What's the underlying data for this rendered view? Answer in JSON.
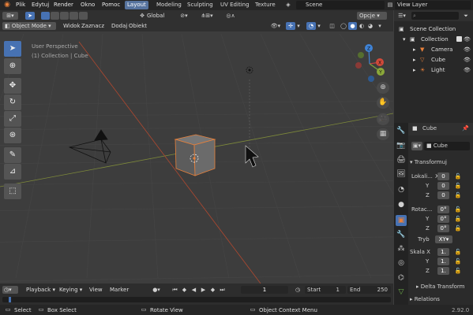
{
  "topbar": {
    "menus": [
      "Plik",
      "Edytuj",
      "Render",
      "Okno",
      "Pomoc"
    ],
    "workspaces": [
      "Layout",
      "Modeling",
      "Sculpting",
      "UV Editing",
      "Texture"
    ],
    "scene": "Scene",
    "view_layer": "View Layer"
  },
  "viewport": {
    "mode": "Object Mode",
    "view": "Widok",
    "select": "Zaznacz",
    "add": "Dodaj",
    "object": "Obiekt",
    "orientation": "Global",
    "options": "Opcje",
    "overlay_title": "User Perspective",
    "overlay_sub": "(1) Collection | Cube"
  },
  "gizmo": {
    "x": "X",
    "y": "Y",
    "z": "Z"
  },
  "timeline": {
    "playback": "Playback",
    "keying": "Keying",
    "view": "View",
    "marker": "Marker",
    "frame": "1",
    "start_label": "Start",
    "start": "1",
    "end_label": "End",
    "end": "250"
  },
  "status": {
    "select": "Select",
    "box_select": "Box Select",
    "rotate": "Rotate View",
    "context": "Object Context Menu",
    "version": "2.92.0"
  },
  "outliner": {
    "scene_collection": "Scene Collection",
    "collection": "Collection",
    "items": [
      "Camera",
      "Cube",
      "Light"
    ]
  },
  "properties": {
    "object_name": "Cube",
    "data_name": "Cube",
    "transform": "Transformuj",
    "location_label": "Lokali...",
    "rotation_label": "Rotac...",
    "mode_label": "Tryb",
    "mode": "XY",
    "scale_label": "Skala X",
    "x": "X",
    "y": "Y",
    "z": "Z",
    "loc": [
      "0",
      "0",
      "0"
    ],
    "rot": [
      "0°",
      "0°",
      "0°"
    ],
    "scale": [
      "1.",
      "1.",
      "1."
    ],
    "delta": "Delta Transform",
    "relations": "Relations"
  },
  "colors": {
    "accent": "#4772b3",
    "axis_x": "#d04a3a",
    "axis_y": "#8ba83a",
    "axis_z": "#3f83d6",
    "cube": "#6b6b6b",
    "object_orange": "#e8803a"
  }
}
